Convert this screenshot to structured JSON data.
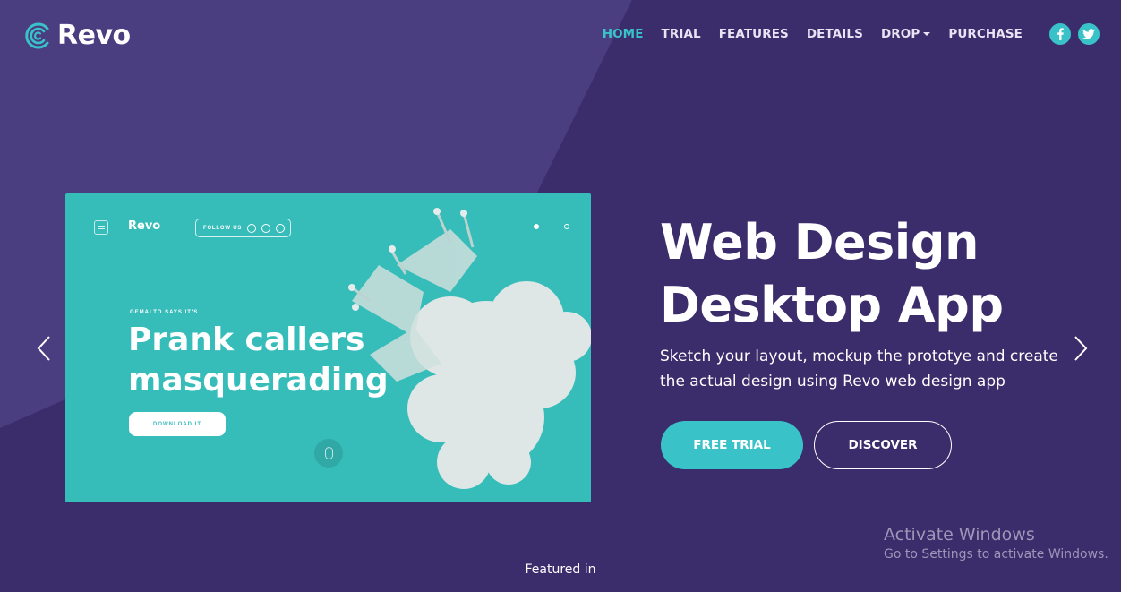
{
  "brand": {
    "name": "Revo"
  },
  "nav": {
    "items": [
      {
        "label": "HOME",
        "active": true
      },
      {
        "label": "TRIAL"
      },
      {
        "label": "FEATURES"
      },
      {
        "label": "DETAILS"
      },
      {
        "label": "DROP",
        "dropdown": true
      },
      {
        "label": "PURCHASE"
      }
    ],
    "social": [
      "facebook-icon",
      "twitter-icon"
    ]
  },
  "slide": {
    "brand": "Revo",
    "follow_label": "FOLLOW US",
    "kicker": "GEMALTO SAYS IT'S",
    "headline_line1": "Prank callers",
    "headline_line2": "masquerading",
    "download_label": "DOWNLOAD IT"
  },
  "hero": {
    "title_line1": "Web Design",
    "title_line2": "Desktop App",
    "subtitle": "Sketch your layout, mockup the prototye and create the actual design using Revo web design app",
    "primary_button": "FREE TRIAL",
    "secondary_button": "DISCOVER"
  },
  "watermark": {
    "title": "Activate Windows",
    "subtitle": "Go to Settings to activate Windows."
  },
  "footer": {
    "featured_label": "Featured in"
  },
  "colors": {
    "accent": "#39c3c8",
    "background": "#3b2c6b",
    "slide": "#36bcb9"
  }
}
